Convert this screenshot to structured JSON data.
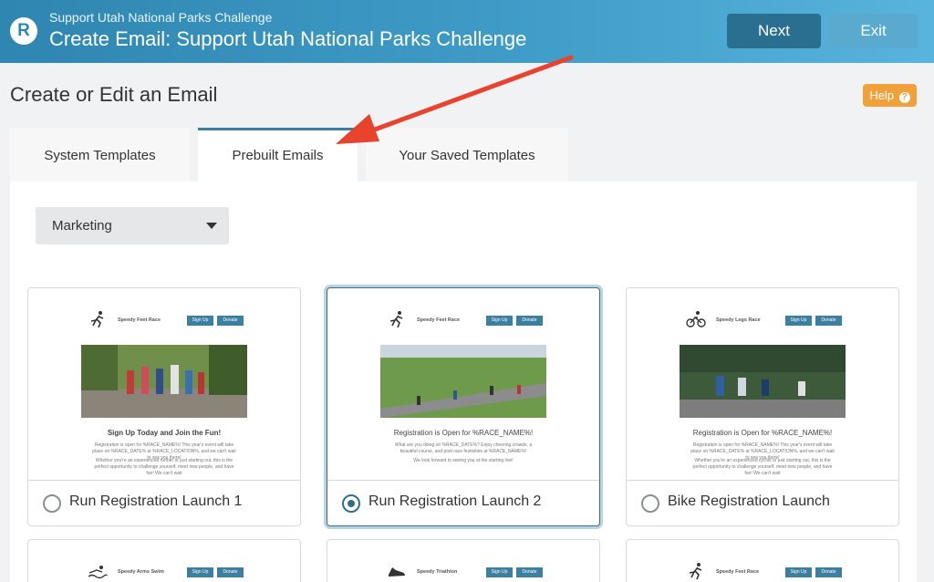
{
  "header": {
    "subtitle": "Support Utah National Parks Challenge",
    "title": "Create Email: Support Utah National Parks Challenge",
    "logo_letter": "R",
    "next_label": "Next",
    "exit_label": "Exit"
  },
  "page": {
    "heading": "Create or Edit an Email",
    "help_label": "Help",
    "help_icon": "?"
  },
  "tabs": [
    {
      "label": "System Templates",
      "active": false
    },
    {
      "label": "Prebuilt Emails",
      "active": true
    },
    {
      "label": "Your Saved Templates",
      "active": false
    }
  ],
  "category_select": {
    "value": "Marketing"
  },
  "cards": [
    {
      "label": "Run Registration Launch 1",
      "selected": false,
      "preview": {
        "brand": "Speedy Feet Race",
        "btn1": "Sign Up",
        "btn2": "Donate",
        "headline": "Sign Up Today and Join the Fun!",
        "body1": "Registration is open for %RACE_NAME%! This year's event will take place on %RACE_DATE% at %RACE_LOCATION%, and we can't wait to see you there!",
        "body2": "Whether you're an experienced runner or just starting out, this is the perfect opportunity to challenge yourself, meet new people, and have fun! We can't wait"
      }
    },
    {
      "label": "Run Registration Launch 2",
      "selected": true,
      "preview": {
        "brand": "Speedy Feet Race",
        "btn1": "Sign Up",
        "btn2": "Donate",
        "headline": "Registration is Open for %RACE_NAME%!",
        "body1": "What are you doing on %RACE_DATE%? Enjoy cheering crowds, a beautiful course, and post race festivities at %RACE_NAME%!",
        "body2": "We look forward to seeing you at the starting line!"
      }
    },
    {
      "label": "Bike Registration Launch",
      "selected": false,
      "preview": {
        "brand": "Speedy Legs Race",
        "btn1": "Sign Up",
        "btn2": "Donate",
        "headline": "Registration is Open for %RACE_NAME%!",
        "body1": "Registration is open for %RACE_NAME%! This year's event will take place on %RACE_DATE% at %RACE_LOCATION%, and we can't wait to see you there!",
        "body2": "Whether you're an experienced cyclist or just starting out, this is the perfect opportunity to challenge yourself, meet new people, and have fun! We can't wait"
      }
    },
    {
      "preview": {
        "brand": "Speedy Arms Swim",
        "btn1": "Sign Up",
        "btn2": "Donate"
      }
    },
    {
      "preview": {
        "brand": "Speedy Triathlon",
        "btn1": "Sign Up",
        "btn2": "Donate"
      }
    },
    {
      "preview": {
        "brand": "Speedy Feet Race",
        "btn1": "Sign Up",
        "btn2": "Donate"
      }
    }
  ],
  "colors": {
    "accent": "#3b7fa1",
    "help": "#f0a13a",
    "arrow": "#e8432f"
  }
}
